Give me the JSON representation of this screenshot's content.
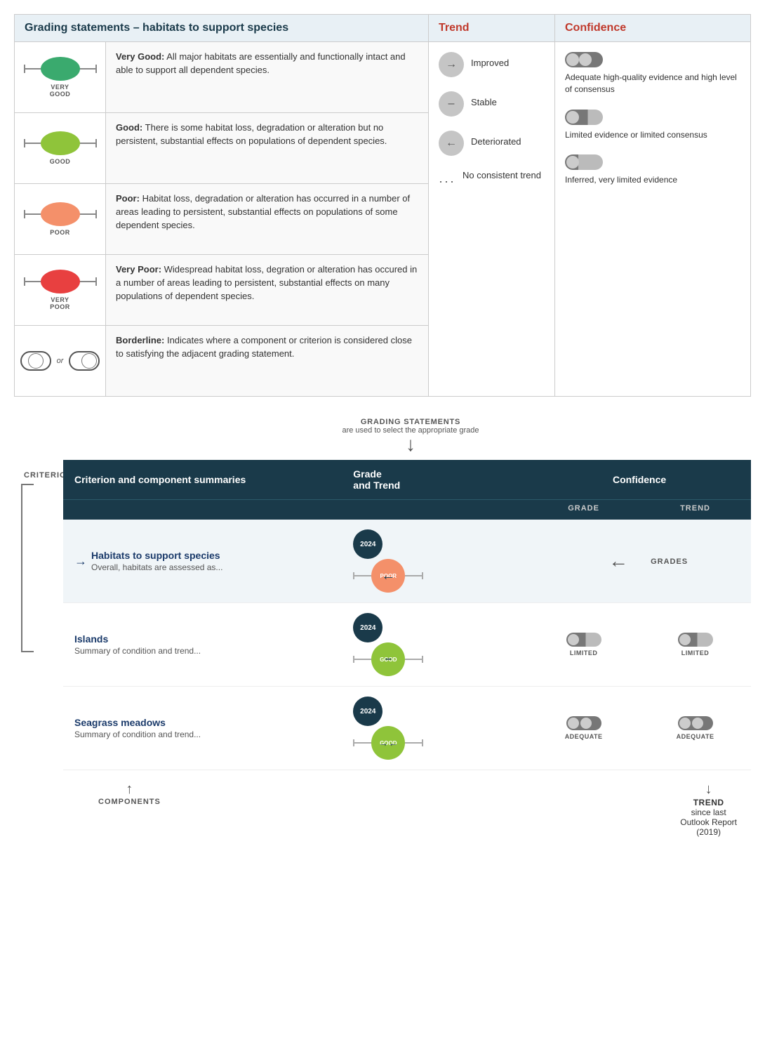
{
  "top_table": {
    "header": "Grading statements – habitats to support species",
    "rows": [
      {
        "grade": "VERY GOOD",
        "color": "#3aaa6e",
        "description_bold": "Very Good:",
        "description": " All major habitats are essentially and functionally intact and able to support all dependent species."
      },
      {
        "grade": "GOOD",
        "color": "#8fc43a",
        "description_bold": "Good:",
        "description": " There is some habitat loss, degradation or alteration but no persistent, substantial effects on populations of dependent species."
      },
      {
        "grade": "POOR",
        "color": "#f4906a",
        "description_bold": "Poor:",
        "description": " Habitat loss, degradation or alteration has occurred in a number of areas leading to persistent, substantial effects on populations of some dependent species."
      },
      {
        "grade": "VERY POOR",
        "color": "#e84040",
        "description_bold": "Very Poor:",
        "description": " Widespread habitat loss, degration or alteration has occured in a number of areas leading to persistent, substantial effects on many populations of dependent species."
      },
      {
        "grade": "BORDERLINE",
        "color": null,
        "description_bold": "Borderline:",
        "description": " Indicates where a component or criterion is considered close to satisfying the adjacent grading statement."
      }
    ]
  },
  "trend_column": {
    "header": "Trend",
    "items": [
      {
        "symbol": "→",
        "label": "Improved"
      },
      {
        "symbol": "–",
        "label": "Stable"
      },
      {
        "symbol": "←",
        "label": "Deteriorated"
      },
      {
        "symbol": "···",
        "label": "No consistent trend"
      }
    ]
  },
  "confidence_column": {
    "header": "Confidence",
    "items": [
      {
        "level": "adequate",
        "text": "Adequate high-quality evidence and high level of consensus"
      },
      {
        "level": "limited",
        "text": "Limited evidence or limited consensus"
      },
      {
        "level": "inferred",
        "text": "Inferred, very limited evidence"
      }
    ]
  },
  "connector": {
    "label_line1": "GRADING STATEMENTS",
    "label_line2": "are used to select the appropriate grade"
  },
  "criterion_label": "CRITERION",
  "bottom_table": {
    "col1_header": "Criterion and component summaries",
    "col2_header": "Grade\nand Trend",
    "col3_header": "Confidence",
    "sub_col3": "GRADE",
    "sub_col4": "TREND",
    "rows": [
      {
        "name": "Habitats to support species",
        "description": "Overall, habitats are assessed as...",
        "year": "2024",
        "grade": "POOR",
        "grade_color": "#f4906a",
        "trend": "←",
        "conf_grade": null,
        "conf_trend": null,
        "is_criterion": true
      },
      {
        "name": "Islands",
        "description": "Summary of condition and trend...",
        "year": "2024",
        "grade": "GOOD",
        "grade_color": "#8fc43a",
        "trend": "–",
        "conf_grade": "LIMITED",
        "conf_trend": "LIMITED",
        "is_criterion": false
      },
      {
        "name": "Seagrass meadows",
        "description": "Summary of condition and trend...",
        "year": "2024",
        "grade": "GOOD",
        "grade_color": "#8fc43a",
        "trend": "→",
        "conf_grade": "ADEQUATE",
        "conf_trend": "ADEQUATE",
        "is_criterion": false
      }
    ]
  },
  "annotations": {
    "components_label": "COMPONENTS",
    "grades_label": "GRADES",
    "trend_label_line1": "TREND",
    "trend_label_line2": "since last",
    "trend_label_line3": "Outlook Report",
    "trend_label_line4": "(2019)"
  }
}
